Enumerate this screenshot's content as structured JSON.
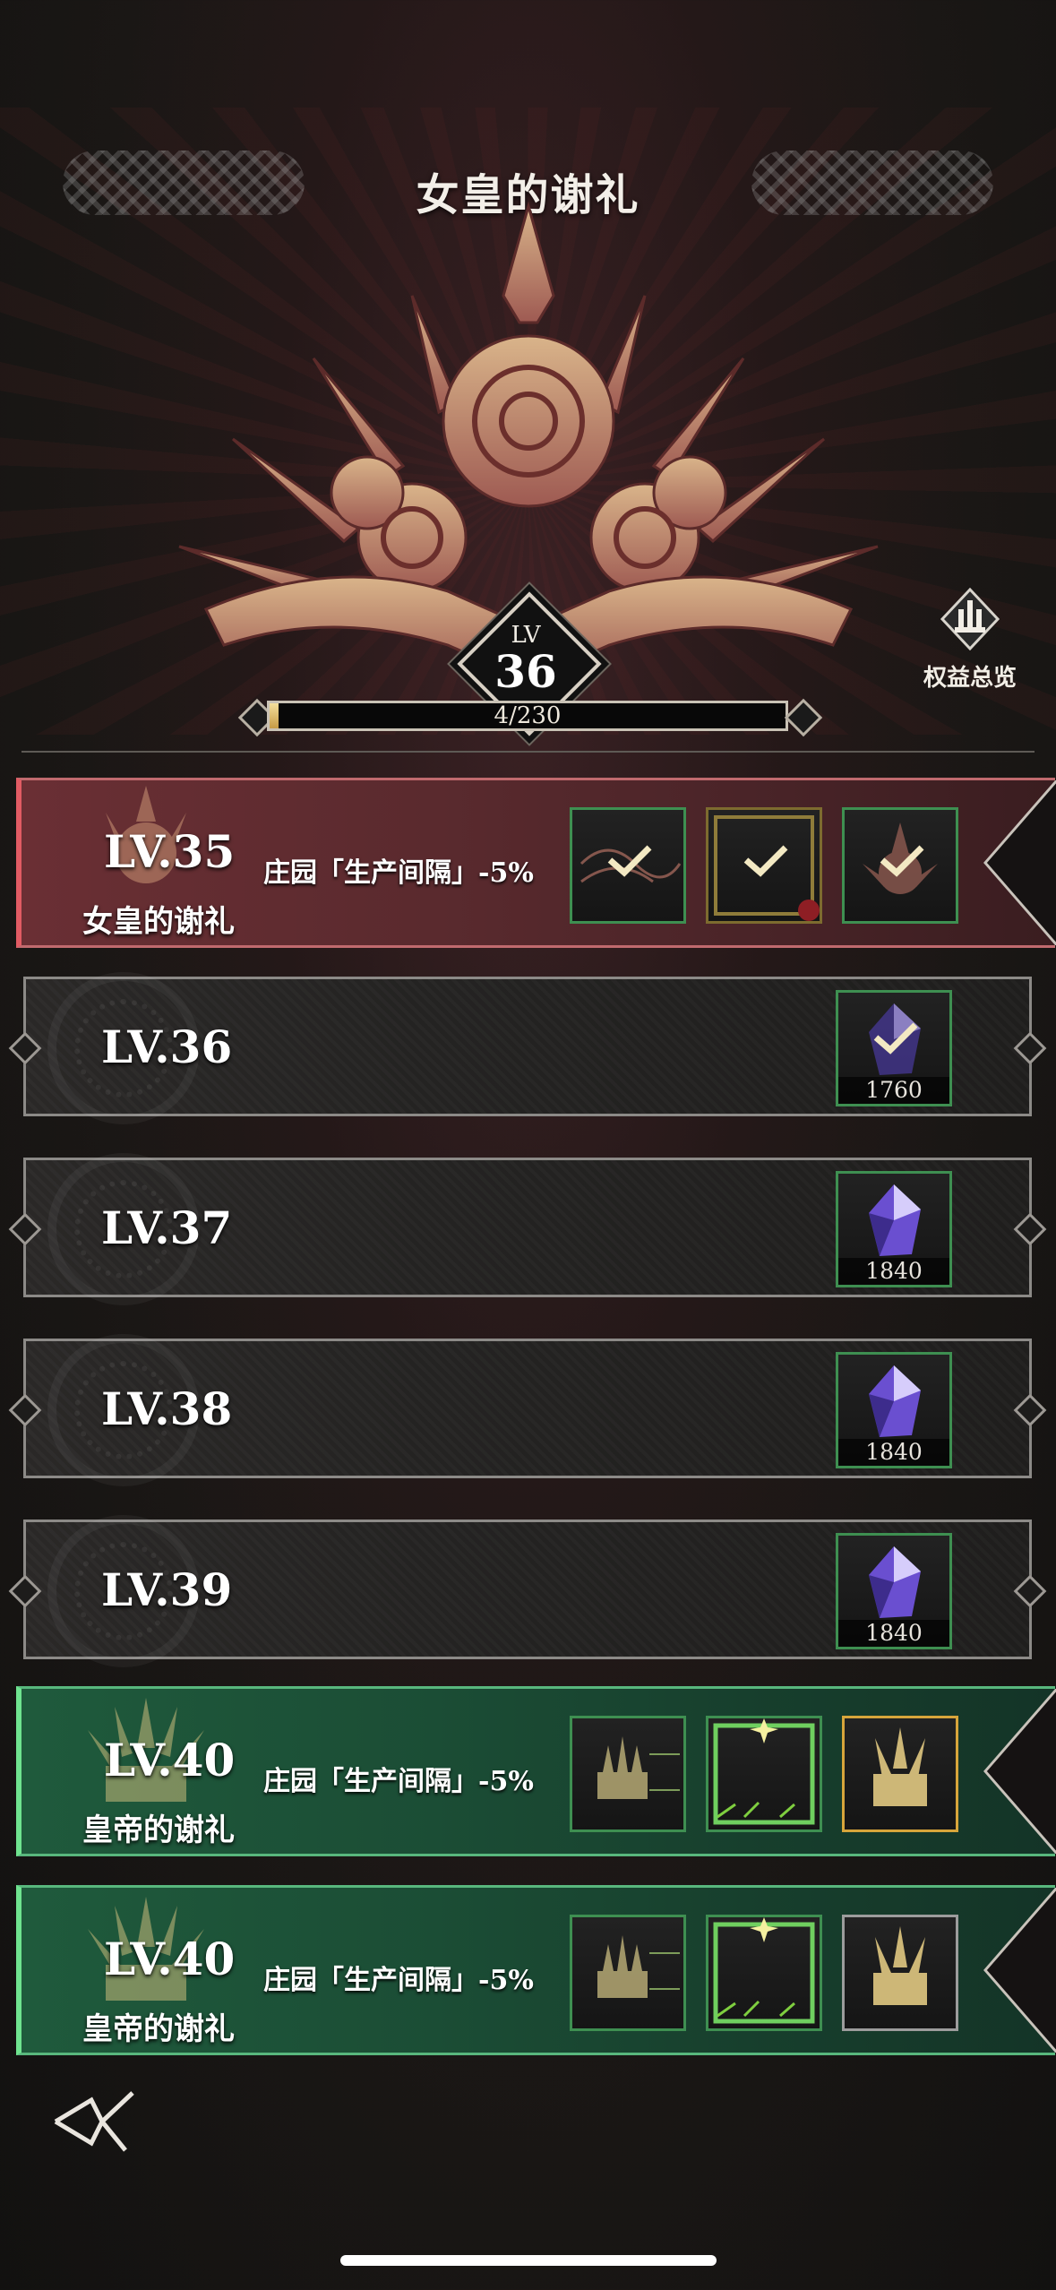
{
  "header": {
    "title": "女皇的谢礼",
    "benefits_label": "权益总览"
  },
  "level": {
    "label": "LV",
    "value": "36",
    "progress_text": "4/230",
    "progress_fraction": 0.017
  },
  "rows": [
    {
      "level": "LV.35",
      "effect": "庄园「生产间隔」-5%",
      "name": "女皇的谢礼",
      "style": "red",
      "rewards": [
        {
          "icon": "crown-frame-icon",
          "claimed": true
        },
        {
          "icon": "rose-frame-icon",
          "claimed": true
        },
        {
          "icon": "crown-emblem-icon",
          "claimed": true
        }
      ]
    },
    {
      "level": "LV.36",
      "rewards": [
        {
          "icon": "crystal-icon",
          "amount": "1760",
          "claimed": true
        }
      ]
    },
    {
      "level": "LV.37",
      "rewards": [
        {
          "icon": "crystal-icon",
          "amount": "1840",
          "claimed": false
        }
      ]
    },
    {
      "level": "LV.38",
      "rewards": [
        {
          "icon": "crystal-icon",
          "amount": "1840",
          "claimed": false
        }
      ]
    },
    {
      "level": "LV.39",
      "rewards": [
        {
          "icon": "crystal-icon",
          "amount": "1840",
          "claimed": false
        }
      ]
    },
    {
      "level": "LV.40",
      "effect": "庄园「生产间隔」-5%",
      "name": "皇帝的谢礼",
      "style": "green",
      "rewards": [
        {
          "icon": "throne-frame-icon"
        },
        {
          "icon": "green-star-frame-icon"
        },
        {
          "icon": "throne-emblem-gold-icon"
        }
      ]
    },
    {
      "level": "LV.40",
      "effect": "庄园「生产间隔」-5%",
      "name": "皇帝的谢礼",
      "style": "green",
      "rewards": [
        {
          "icon": "throne-frame-icon"
        },
        {
          "icon": "green-star-frame-icon"
        },
        {
          "icon": "throne-emblem-silver-icon"
        }
      ]
    }
  ],
  "colors": {
    "red_accent": "#e15b63",
    "green_accent": "#6fe38f",
    "reward_border_green": "#3e8f51",
    "reward_border_gold": "#d7a53b",
    "crystal": "#6a4fd0",
    "check": "#f3e9c3"
  }
}
